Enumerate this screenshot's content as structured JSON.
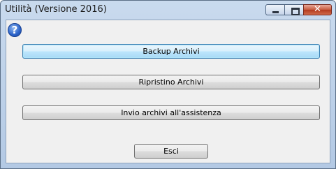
{
  "window": {
    "title": "Utilità (Versione 2016)",
    "controls": {
      "minimize": "minimize-icon",
      "maximize": "maximize-icon",
      "close": "close-icon"
    }
  },
  "help": {
    "glyph": "?",
    "icon": "help-icon"
  },
  "buttons": {
    "backup": "Backup Archivi",
    "restore": "Ripristino Archivi",
    "send": "Invio archivi all'assistenza",
    "exit": "Esci"
  }
}
